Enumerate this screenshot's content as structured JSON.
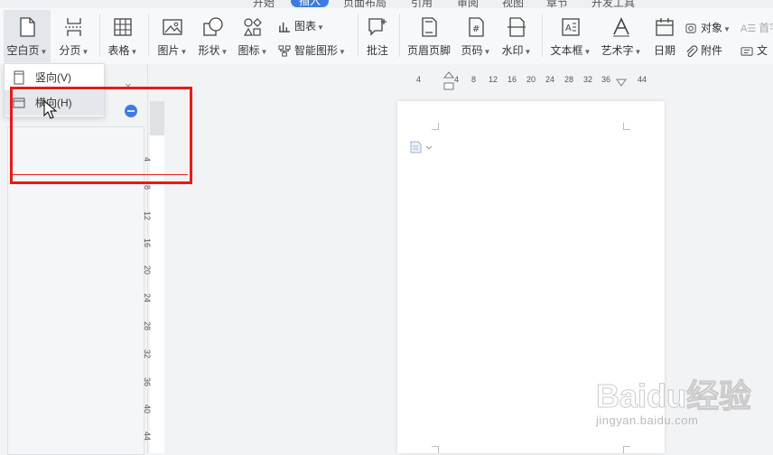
{
  "tabs": [
    "开始",
    "插入",
    "页面布局",
    "引用",
    "审阅",
    "视图",
    "章节",
    "开发工具"
  ],
  "active_tab": "插入",
  "ribbon": {
    "blank_page": "空白页",
    "page_break": "分页",
    "table": "表格",
    "picture": "图片",
    "shape": "形状",
    "icon": "图标",
    "chart": "图表",
    "smart_art": "智能图形",
    "comment": "批注",
    "header_footer": "页眉页脚",
    "page_number": "页码",
    "watermark": "水印",
    "text_box": "文本框",
    "word_art": "艺术字",
    "date": "日期",
    "object": "对象",
    "attachment": "附件",
    "drop_cap": "首字",
    "doc_part": "文"
  },
  "dropdown": {
    "portrait": "竖向(V)",
    "landscape": "横向(H)"
  },
  "hruler_ticks": [
    "4",
    "4",
    "8",
    "12",
    "16",
    "20",
    "24",
    "28",
    "32",
    "36",
    "44"
  ],
  "vruler_ticks": [
    "4",
    "8",
    "12",
    "16",
    "20",
    "24",
    "28",
    "32",
    "36",
    "40",
    "44"
  ],
  "watermark": {
    "brand": "Baidu经验",
    "url": "jingyan.baidu.com"
  },
  "colors": {
    "accent": "#3d7be0",
    "highlight": "#e61a1a"
  }
}
